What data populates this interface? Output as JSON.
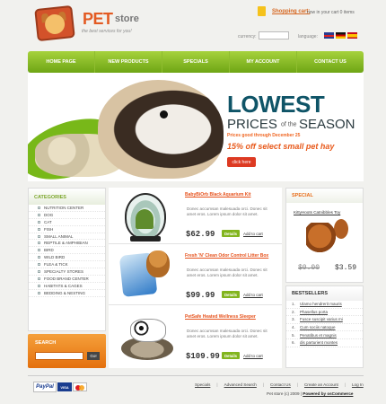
{
  "header": {
    "logo_pet": "PET",
    "logo_store": "store",
    "tagline": "the best services for you!",
    "cart_label": "Shopping cart:",
    "cart_status": "now in your cart 0 items",
    "currency_label": "currency:",
    "language_label": "language:"
  },
  "nav": {
    "items": [
      "HOME PAGE",
      "NEW PRODUCTS",
      "SPECIALS",
      "MY ACCOUNT",
      "CONTACT US"
    ]
  },
  "banner": {
    "title": "LOWEST",
    "prices": "PRICES",
    "of": "of the",
    "season": "SEASON",
    "dates": "Prices good through December 25",
    "offer": "15% off select small pet hay",
    "button": "click here"
  },
  "categories": {
    "title": "CATEGORIES",
    "items": [
      "NUTRITION CENTER",
      "DOG",
      "CAT",
      "FISH",
      "SMALL ANIMAL",
      "REPTILE & AMPHIBIAN",
      "BIRD",
      "WILD BIRD",
      "FLEA & TICK",
      "SPECIALTY STORES",
      "FOOD BRAND CENTER",
      "HABITATS & CAGES",
      "BEDDING & NESTING"
    ]
  },
  "search": {
    "title": "SEARCH",
    "button": "Go!"
  },
  "products": [
    {
      "title": "BabyBiOrb Black Aquarium Kit",
      "desc": "Donec accumsan malesuada orci. Donec sit amet eros. Lorem ipsum dolor sit amet.",
      "price": "$62.99",
      "details": "Details",
      "cart": "Add to cart"
    },
    {
      "title": "Fresh 'N' Clean Odor Control Litter Box",
      "desc": "Donec accumsan malesuada orci. Donec sit amet eros. Lorem ipsum dolor sit amet.",
      "price": "$99.99",
      "details": "Details",
      "cart": "Add to cart"
    },
    {
      "title": "PetSafe Heated Wellness Sleeper",
      "desc": "Donec accumsan malesuada orci. Donec sit amet eros. Lorem ipsum dolor sit amet.",
      "price": "$109.99",
      "details": "Details",
      "cart": "Add to cart"
    }
  ],
  "special": {
    "title": "SPECIAL",
    "name": "KittyHoots Catnibbles Toy",
    "old_price": "$0.00",
    "new_price": "$3.59"
  },
  "bestsellers": {
    "title": "BESTSELLERS",
    "items": [
      {
        "num": "1.",
        "label": "Ulamo hendrerit mauris"
      },
      {
        "num": "2.",
        "label": "Phasellus porta"
      },
      {
        "num": "3.",
        "label": "Fusce suscipit varius mi"
      },
      {
        "num": "4.",
        "label": "Cum sociis natoque"
      },
      {
        "num": "5.",
        "label": "Penatibus et magnis"
      },
      {
        "num": "6.",
        "label": "dis parturient montes"
      }
    ]
  },
  "footer": {
    "payment": "PayPal",
    "visa": "VISA",
    "links": [
      "Specials",
      "Advanced Search",
      "Contact Us",
      "Create an Account",
      "Log In"
    ],
    "copyright_prefix": "Pet store (c) 2009",
    "powered": "Powered by osCommerce"
  }
}
